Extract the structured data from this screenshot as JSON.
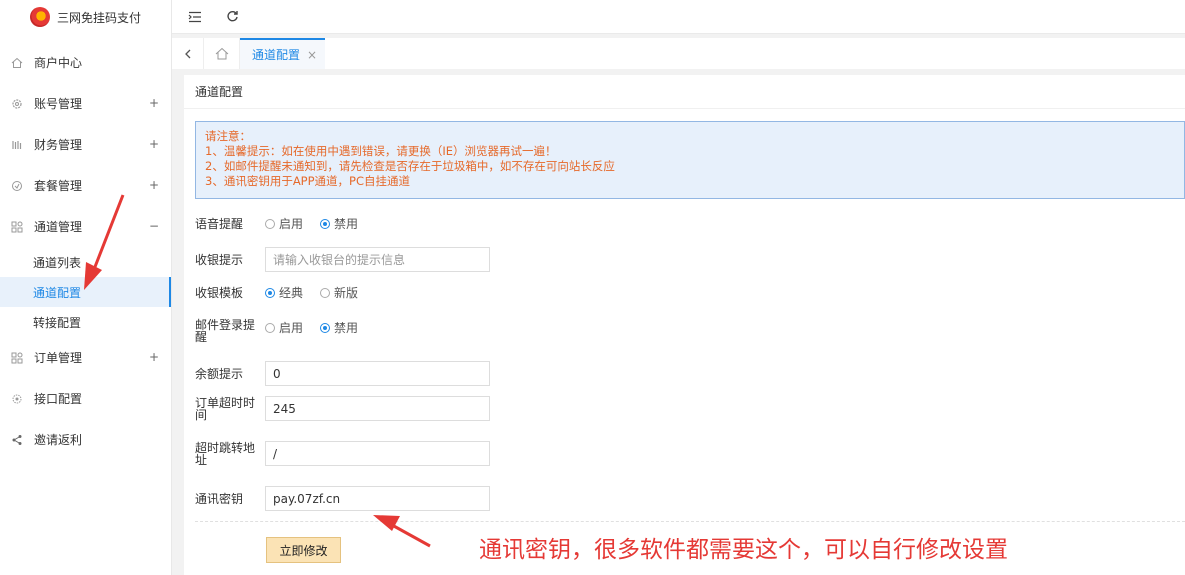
{
  "app": {
    "title": "三网免挂码支付"
  },
  "colors": {
    "accent": "#1e88e5",
    "notice_text": "#e6692a",
    "annotation": "#e53935",
    "submit_bg": "#fbe3b5"
  },
  "sidebar": {
    "items": [
      {
        "label": "商户中心",
        "icon": "home-icon"
      },
      {
        "label": "账号管理",
        "icon": "gear-icon",
        "toggle": "+"
      },
      {
        "label": "财务管理",
        "icon": "finance-icon",
        "toggle": "+"
      },
      {
        "label": "套餐管理",
        "icon": "package-icon",
        "toggle": "+"
      },
      {
        "label": "通道管理",
        "icon": "channel-icon",
        "toggle": "−"
      },
      {
        "label": "订单管理",
        "icon": "order-icon",
        "toggle": "+"
      },
      {
        "label": "接口配置",
        "icon": "api-icon"
      },
      {
        "label": "邀请返利",
        "icon": "share-icon"
      }
    ],
    "sub_items": [
      "通道列表",
      "通道配置",
      "转接配置"
    ]
  },
  "tabs": {
    "active": "通道配置",
    "close": "×"
  },
  "panel": {
    "title": "通道配置",
    "notice": {
      "heading": "请注意：",
      "lines": [
        "1、温馨提示：如在使用中遇到错误，请更换（IE）浏览器再试一遍！",
        "2、如邮件提醒未通知到，请先检查是否存在于垃圾箱中，如不存在可向站长反应",
        "3、通讯密钥用于APP通道，PC自挂通道"
      ]
    },
    "form": {
      "voice_label": "语音提醒",
      "voice_on": "启用",
      "voice_off": "禁用",
      "cashier_hint_label": "收银提示",
      "cashier_hint_placeholder": "请输入收银台的提示信息",
      "template_label": "收银模板",
      "template_classic": "经典",
      "template_new": "新版",
      "email_label": "邮件登录提醒",
      "email_on": "启用",
      "email_off": "禁用",
      "balance_label": "余额提示",
      "balance_value": "0",
      "timeout_label": "订单超时时间",
      "timeout_value": "245",
      "redirect_label": "超时跳转地址",
      "redirect_value": "/",
      "key_label": "通讯密钥",
      "key_value": "pay.07zf.cn",
      "submit": "立即修改"
    }
  },
  "annotation": {
    "text": "通讯密钥，很多软件都需要这个，可以自行修改设置"
  }
}
